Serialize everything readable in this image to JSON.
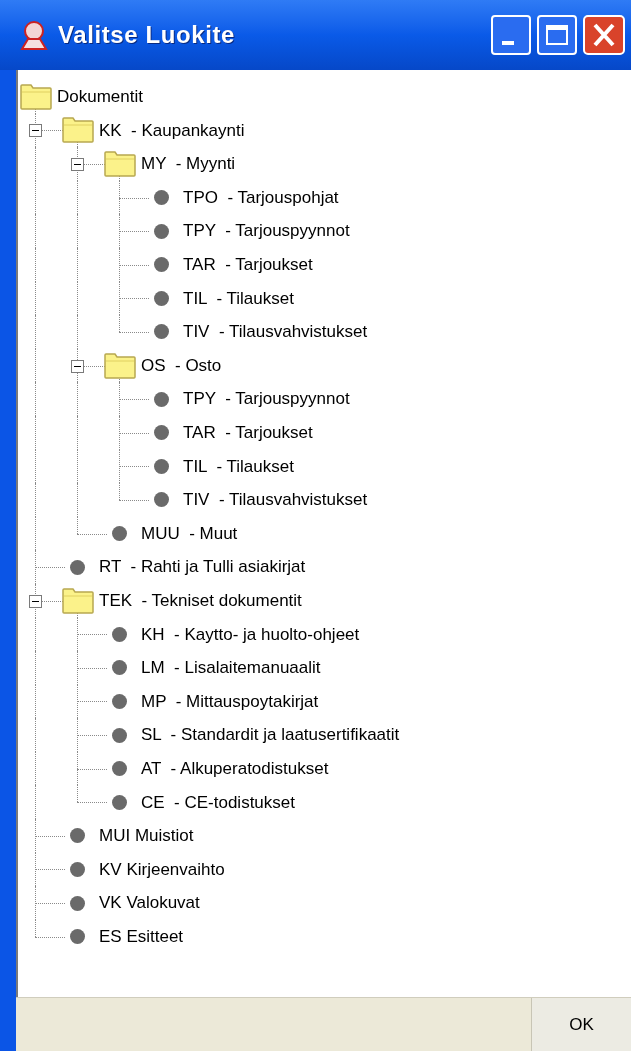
{
  "window": {
    "title": "Valitse Luokite"
  },
  "tree": {
    "label": "Dokumentit",
    "kind": "folder",
    "children": [
      {
        "label": "KK  - Kaupankaynti",
        "kind": "folder",
        "expanded": true,
        "children": [
          {
            "label": "MY  - Myynti",
            "kind": "folder",
            "expanded": true,
            "children": [
              {
                "label": "TPO  - Tarjouspohjat",
                "kind": "leaf"
              },
              {
                "label": "TPY  - Tarjouspyynnot",
                "kind": "leaf"
              },
              {
                "label": "TAR  - Tarjoukset",
                "kind": "leaf"
              },
              {
                "label": "TIL  - Tilaukset",
                "kind": "leaf"
              },
              {
                "label": "TIV  - Tilausvahvistukset",
                "kind": "leaf"
              }
            ]
          },
          {
            "label": "OS  - Osto",
            "kind": "folder",
            "expanded": true,
            "children": [
              {
                "label": "TPY  - Tarjouspyynnot",
                "kind": "leaf"
              },
              {
                "label": "TAR  - Tarjoukset",
                "kind": "leaf"
              },
              {
                "label": "TIL  - Tilaukset",
                "kind": "leaf"
              },
              {
                "label": "TIV  - Tilausvahvistukset",
                "kind": "leaf"
              }
            ]
          },
          {
            "label": "MUU  - Muut",
            "kind": "leaf"
          }
        ]
      },
      {
        "label": "RT  - Rahti ja Tulli asiakirjat",
        "kind": "leaf"
      },
      {
        "label": "TEK  - Tekniset dokumentit",
        "kind": "folder",
        "expanded": true,
        "children": [
          {
            "label": "KH  - Kaytto- ja huolto-ohjeet",
            "kind": "leaf"
          },
          {
            "label": "LM  - Lisalaitemanuaalit",
            "kind": "leaf"
          },
          {
            "label": "MP  - Mittauspoytakirjat",
            "kind": "leaf"
          },
          {
            "label": "SL  - Standardit ja laatusertifikaatit",
            "kind": "leaf"
          },
          {
            "label": "AT  - Alkuperatodistukset",
            "kind": "leaf"
          },
          {
            "label": "CE  - CE-todistukset",
            "kind": "leaf"
          }
        ]
      },
      {
        "label": "MUI Muistiot",
        "kind": "leaf"
      },
      {
        "label": "KV Kirjeenvaihto",
        "kind": "leaf"
      },
      {
        "label": "VK Valokuvat",
        "kind": "leaf"
      },
      {
        "label": "ES Esitteet",
        "kind": "leaf"
      }
    ]
  },
  "buttons": [
    {
      "label": "OK"
    }
  ]
}
